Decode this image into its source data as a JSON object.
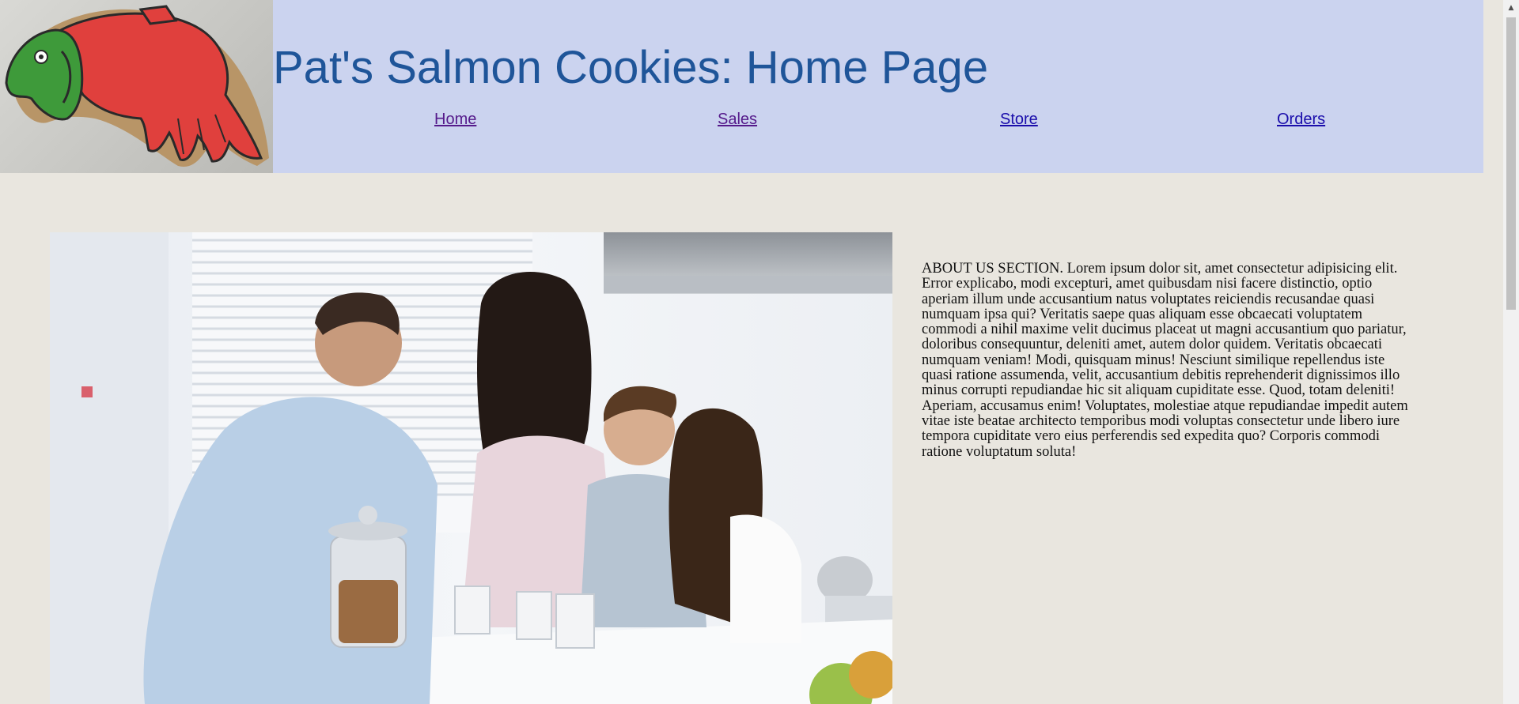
{
  "header": {
    "title": "Pat's Salmon Cookies: Home Page",
    "background": "#cbd3ef",
    "title_color": "#1f5599",
    "logo_icon": "salmon-cookie-logo"
  },
  "nav": {
    "items": [
      {
        "label": "Home"
      },
      {
        "label": "Sales"
      },
      {
        "label": "Store"
      },
      {
        "label": "Orders"
      }
    ]
  },
  "main": {
    "hero_icon": "family-kitchen-photo",
    "about_text": "ABOUT US SECTION. Lorem ipsum dolor sit, amet consectetur adipisicing elit. Error explicabo, modi excepturi, amet quibusdam nisi facere distinctio, optio aperiam illum unde accusantium natus voluptates reiciendis recusandae quasi numquam ipsa qui? Veritatis saepe quas aliquam esse obcaecati voluptatem commodi a nihil maxime velit ducimus placeat ut magni accusantium quo pariatur, doloribus consequuntur, deleniti amet, autem dolor quidem. Veritatis obcaecati numquam veniam! Modi, quisquam minus! Nesciunt similique repellendus iste quasi ratione assumenda, velit, accusantium debitis reprehenderit dignissimos illo minus corrupti repudiandae hic sit aliquam cupiditate esse. Quod, totam deleniti! Aperiam, accusamus enim! Voluptates, molestiae atque repudiandae impedit autem vitae iste beatae architecto temporibus modi voluptas consectetur unde libero iure tempora cupiditate vero eius perferendis sed expedita quo? Corporis commodi ratione voluptatum soluta!"
  },
  "page": {
    "background": "#e9e6df"
  }
}
